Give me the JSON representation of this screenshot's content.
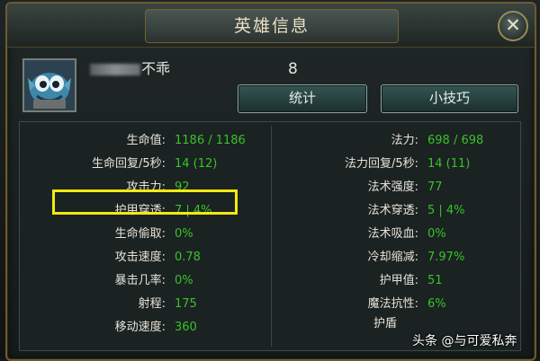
{
  "window": {
    "title": "英雄信息",
    "close_glyph": "✕",
    "close_icon": "close-icon"
  },
  "hero": {
    "name_visible": "不乖",
    "level": "8",
    "avatar_icon": "fish-hero-portrait"
  },
  "buttons": {
    "stats_label": "统计",
    "tips_label": "小技巧"
  },
  "stats_left": [
    {
      "label": "生命值:",
      "value": "1186 / 1186"
    },
    {
      "label": "生命回复/5秒:",
      "value": "14 (12)"
    },
    {
      "label": "攻击力:",
      "value": "92"
    },
    {
      "label": "护甲穿透:",
      "value": "7 | 4%"
    },
    {
      "label": "生命偷取:",
      "value": "0%"
    },
    {
      "label": "攻击速度:",
      "value": "0.78"
    },
    {
      "label": "暴击几率:",
      "value": "0%"
    },
    {
      "label": "射程:",
      "value": "175"
    },
    {
      "label": "移动速度:",
      "value": "360"
    }
  ],
  "stats_right": [
    {
      "label": "法力:",
      "value": "698 / 698"
    },
    {
      "label": "法力回复/5秒:",
      "value": "14 (11)"
    },
    {
      "label": "法术强度:",
      "value": "77"
    },
    {
      "label": "法术穿透:",
      "value": "5 | 4%"
    },
    {
      "label": "法术吸血:",
      "value": "0%"
    },
    {
      "label": "冷却缩减:",
      "value": "7.97%"
    },
    {
      "label": "护甲值:",
      "value": "51"
    },
    {
      "label": "魔法抗性:",
      "value": "6%"
    }
  ],
  "clipped_label": "护盾",
  "watermark": {
    "text": "头条 @与可爱私奔"
  },
  "colors": {
    "stat_value": "#39c22a",
    "highlight_box": "#f2ea0f",
    "frame_gold": "#6d5b2c"
  }
}
